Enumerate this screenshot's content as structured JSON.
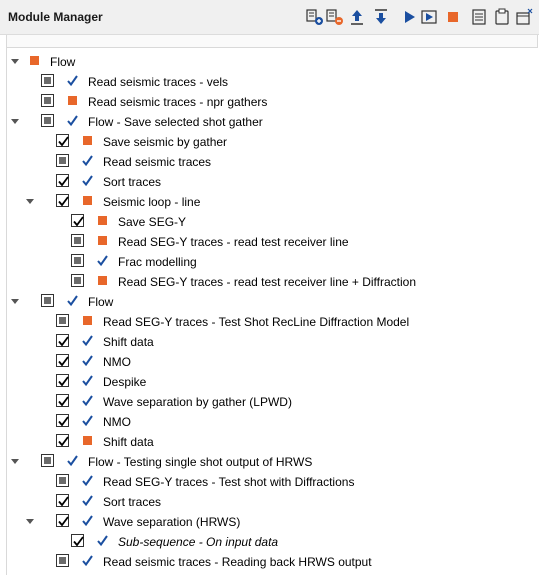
{
  "panel": {
    "title": "Module Manager"
  },
  "toolbar": [
    {
      "icon": "add-module-icon"
    },
    {
      "icon": "remove-module-icon"
    },
    {
      "icon": "move-up-icon"
    },
    {
      "icon": "move-down-icon"
    },
    {
      "icon": "run-icon"
    },
    {
      "icon": "run-step-icon"
    },
    {
      "icon": "stop-icon"
    },
    {
      "icon": "properties-icon"
    },
    {
      "icon": "clipboard-icon"
    },
    {
      "icon": "window-menu-icon"
    }
  ],
  "colors": {
    "accent_orange": "#e8672a",
    "check_blue": "#1b4fa0",
    "checkbox_fill": "#6b6b6b"
  },
  "tree": [
    {
      "label": "Flow",
      "level": 0,
      "expander": "expanded",
      "checkbox": "none",
      "status": "orange"
    },
    {
      "label": "Read seismic traces - vels",
      "level": 1,
      "expander": "none",
      "checkbox": "filled",
      "status": "check"
    },
    {
      "label": "Read seismic traces - npr gathers",
      "level": 1,
      "expander": "none",
      "checkbox": "filled",
      "status": "orange"
    },
    {
      "label": "Flow - Save selected shot gather",
      "level": 1,
      "expander": "expanded",
      "checkbox": "filled",
      "status": "check"
    },
    {
      "label": "Save seismic by gather",
      "level": 2,
      "expander": "none",
      "checkbox": "checked",
      "status": "orange"
    },
    {
      "label": "Read seismic traces",
      "level": 2,
      "expander": "none",
      "checkbox": "filled",
      "status": "check"
    },
    {
      "label": "Sort traces",
      "level": 2,
      "expander": "none",
      "checkbox": "checked",
      "status": "check"
    },
    {
      "label": "Seismic loop - line",
      "level": 2,
      "expander": "expanded",
      "checkbox": "checked",
      "status": "orange"
    },
    {
      "label": "Save SEG-Y",
      "level": 3,
      "expander": "none",
      "checkbox": "checked",
      "status": "orange"
    },
    {
      "label": "Read SEG-Y traces - read test receiver line",
      "level": 3,
      "expander": "none",
      "checkbox": "filled",
      "status": "orange"
    },
    {
      "label": "Frac modelling",
      "level": 3,
      "expander": "none",
      "checkbox": "filled",
      "status": "check"
    },
    {
      "label": "Read SEG-Y traces - read test receiver line + Diffraction",
      "level": 3,
      "expander": "none",
      "checkbox": "filled",
      "status": "orange"
    },
    {
      "label": "Flow",
      "level": 1,
      "expander": "expanded",
      "checkbox": "filled",
      "status": "check"
    },
    {
      "label": "Read SEG-Y traces - Test Shot RecLine Diffraction Model",
      "level": 2,
      "expander": "none",
      "checkbox": "filled",
      "status": "orange"
    },
    {
      "label": "Shift data",
      "level": 2,
      "expander": "none",
      "checkbox": "checked",
      "status": "check"
    },
    {
      "label": "NMO",
      "level": 2,
      "expander": "none",
      "checkbox": "checked",
      "status": "check"
    },
    {
      "label": "Despike",
      "level": 2,
      "expander": "none",
      "checkbox": "checked",
      "status": "check"
    },
    {
      "label": "Wave separation by gather (LPWD)",
      "level": 2,
      "expander": "none",
      "checkbox": "checked",
      "status": "check"
    },
    {
      "label": "NMO",
      "level": 2,
      "expander": "none",
      "checkbox": "checked",
      "status": "check"
    },
    {
      "label": "Shift data",
      "level": 2,
      "expander": "none",
      "checkbox": "checked",
      "status": "orange"
    },
    {
      "label": "Flow - Testing single shot output of HRWS",
      "level": 1,
      "expander": "expanded",
      "checkbox": "filled",
      "status": "check"
    },
    {
      "label": "Read SEG-Y traces - Test shot with Diffractions",
      "level": 2,
      "expander": "none",
      "checkbox": "filled",
      "status": "check"
    },
    {
      "label": "Sort traces",
      "level": 2,
      "expander": "none",
      "checkbox": "checked",
      "status": "check"
    },
    {
      "label": "Wave separation (HRWS)",
      "level": 2,
      "expander": "expanded",
      "checkbox": "checked",
      "status": "check"
    },
    {
      "label": "Sub-sequence - On input data",
      "level": 3,
      "expander": "none",
      "checkbox": "checked",
      "status": "check",
      "italic": true
    },
    {
      "label": "Read seismic traces - Reading back HRWS output",
      "level": 2,
      "expander": "none",
      "checkbox": "filled",
      "status": "check"
    }
  ]
}
